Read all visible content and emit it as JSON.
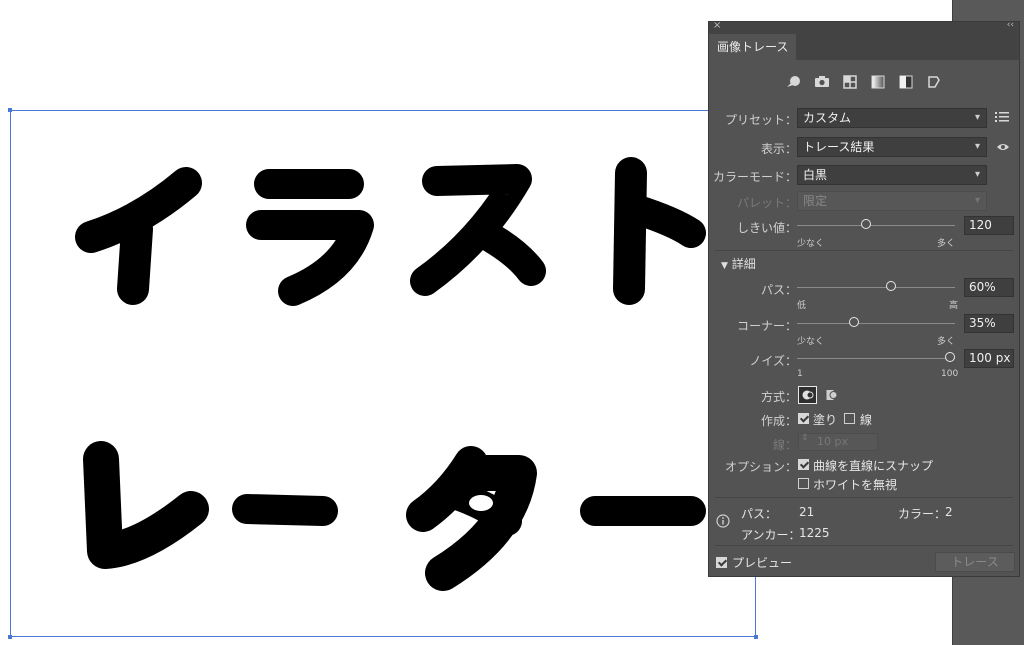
{
  "panel": {
    "tab": "画像トレース",
    "close_glyph": "×",
    "collapse_glyph": "‹‹",
    "preset_icons": [
      "auto-color-icon",
      "photo-icon",
      "grid-icon",
      "gradient-icon",
      "bw-icon",
      "outline-icon"
    ],
    "preset_label": "プリセット：",
    "preset_value": "カスタム",
    "view_label": "表示：",
    "view_value": "トレース結果",
    "mode_label": "カラーモード：",
    "mode_value": "白黒",
    "palette_label": "パレット：",
    "palette_value": "限定",
    "threshold": {
      "label": "しきい値：",
      "value": "120",
      "min_label": "少なく",
      "max_label": "多く",
      "fraction": 0.43
    },
    "advanced_label": "詳細",
    "paths": {
      "label": "パス：",
      "value": "60%",
      "min_label": "低",
      "max_label": "高",
      "fraction": 0.6
    },
    "corners": {
      "label": "コーナー：",
      "value": "35%",
      "min_label": "少なく",
      "max_label": "多く",
      "fraction": 0.35
    },
    "noise": {
      "label": "ノイズ：",
      "value": "100 px",
      "min_label": "1",
      "max_label": "100",
      "fraction": 1.0
    },
    "method_label": "方式：",
    "create_label": "作成：",
    "fill_label": "塗り",
    "stroke_label": "線",
    "stroke_width_label": "線：",
    "stroke_width_value": "10 px",
    "options_label": "オプション：",
    "snap_label": "曲線を直線にスナップ",
    "ignore_white_label": "ホワイトを無視",
    "info": {
      "paths_label": "パス：",
      "paths_value": "21",
      "colors_label": "カラー：",
      "colors_value": "2",
      "anchors_label": "アンカー：",
      "anchors_value": "1225"
    },
    "preview_label": "プレビュー",
    "trace_button": "トレース"
  }
}
